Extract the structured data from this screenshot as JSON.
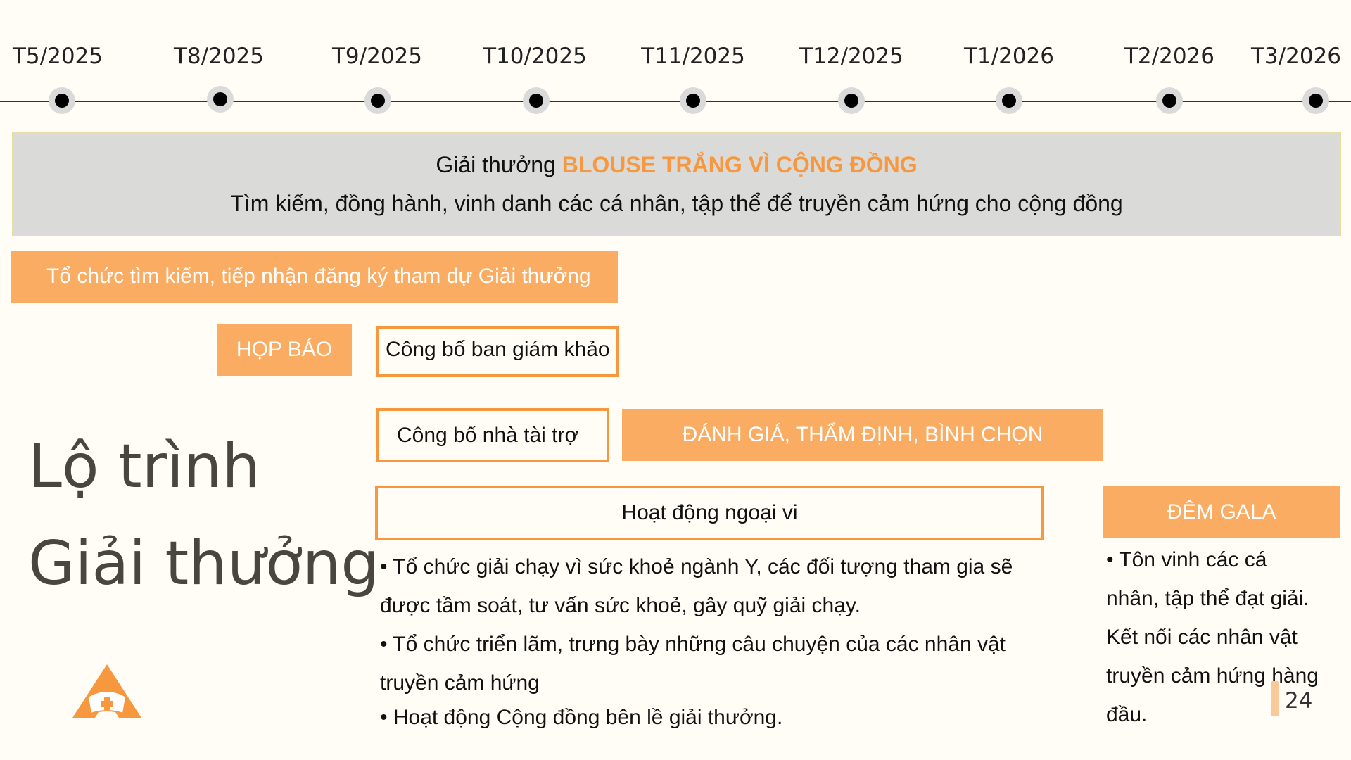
{
  "timeline": {
    "months": [
      "T5/2025",
      "T8/2025",
      "T9/2025",
      "T10/2025",
      "T11/2025",
      "T12/2025",
      "T1/2026",
      "T2/2026",
      "T3/2026"
    ]
  },
  "banner": {
    "prefix": "Giải thưởng ",
    "highlight": "BLOUSE TRẮNG VÌ CỘNG ĐỒNG",
    "subtitle": "Tìm kiếm, đồng hành, vinh danh các cá nhân, tập thể để truyền cảm hứng cho cộng đồng"
  },
  "phases": {
    "registration": "Tổ chức tìm kiếm, tiếp nhận đăng ký tham dự Giải thưởng",
    "press": "HỌP BÁO",
    "jury": "Công bố ban giám khảo",
    "sponsor": "Công bố nhà tài trợ",
    "evaluation": "ĐÁNH GIÁ, THẨM ĐỊNH, BÌNH CHỌN",
    "activities": "Hoạt động ngoại vi",
    "gala": "ĐÊM GALA"
  },
  "title": {
    "line1": "Lộ trình",
    "line2": "Giải thưởng"
  },
  "activities_text": {
    "l1": "• Tổ chức giải chạy vì sức khoẻ ngành Y, các đối tượng tham gia sẽ",
    "l2": "được tầm soát, tư vấn sức khoẻ, gây quỹ giải chạy.",
    "l3": "• Tổ chức triển lãm, trưng bày những câu chuyện của các nhân vật",
    "l4": "truyền cảm hứng",
    "l5": "• Hoạt động Cộng đồng bên lề giải thưởng."
  },
  "gala_text": {
    "l1": "• Tôn vinh các cá",
    "l2": "nhân, tập thể đạt giải.",
    "l3": "Kết nối các nhân vật",
    "l4": "truyền cảm hứng hàng",
    "l5": "đầu."
  },
  "page_number": "24",
  "colors": {
    "accent": "#F7973E",
    "accent_fill": "#F9AC62",
    "banner_bg": "#DADAD8",
    "background": "#FFFDF6"
  },
  "icons": {
    "logo": "nurse-cap-triangle-logo"
  }
}
